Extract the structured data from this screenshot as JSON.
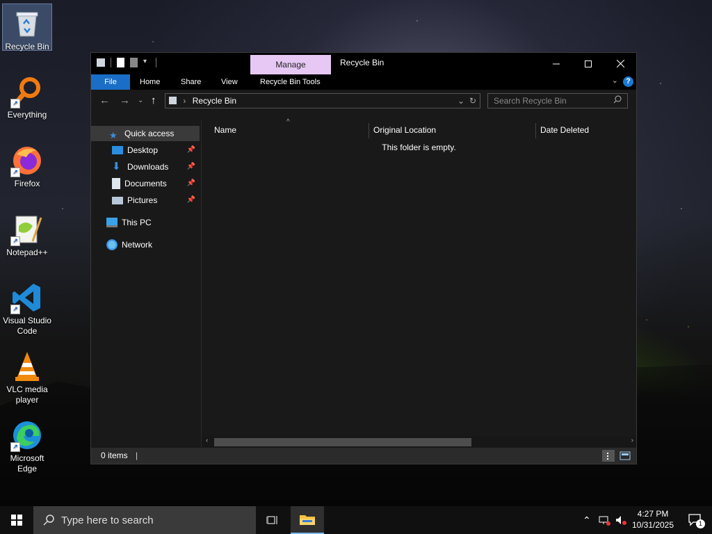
{
  "desktop": {
    "icons": [
      {
        "label": "Recycle Bin"
      },
      {
        "label": "Everything"
      },
      {
        "label": "Firefox"
      },
      {
        "label": "Notepad++"
      },
      {
        "label": "Visual Studio Code"
      },
      {
        "label": "VLC media player"
      },
      {
        "label": "Microsoft Edge"
      }
    ]
  },
  "window": {
    "title": "Recycle Bin",
    "manage_label": "Manage",
    "ribbon_tabs": [
      "File",
      "Home",
      "Share",
      "View",
      "Recycle Bin Tools"
    ],
    "address": "Recycle Bin",
    "search_placeholder": "Search Recycle Bin",
    "nav": {
      "quick_access": "Quick access",
      "pinned": [
        "Desktop",
        "Downloads",
        "Documents",
        "Pictures"
      ],
      "this_pc": "This PC",
      "network": "Network"
    },
    "columns": [
      "Name",
      "Original Location",
      "Date Deleted"
    ],
    "empty_message": "This folder is empty.",
    "status": "0 items"
  },
  "taskbar": {
    "search_placeholder": "Type here to search",
    "time": "4:27 PM",
    "date": "10/31/2025",
    "notification_count": "1"
  },
  "colors": {
    "accent": "#1a6ec7",
    "manage_tab": "#e7c8f4",
    "window_bg": "#191919"
  }
}
